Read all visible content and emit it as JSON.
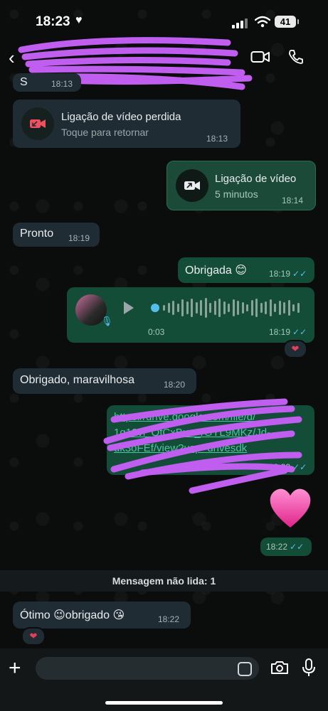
{
  "status_bar": {
    "time": "18:23",
    "heart": "♥",
    "battery": "41"
  },
  "header": {
    "back": "‹",
    "contact_name": ""
  },
  "messages": {
    "partial_top": {
      "text": "S",
      "time": "18:13"
    },
    "missed_call": {
      "title": "Ligação de vídeo perdida",
      "subtitle": "Toque para retornar",
      "time": "18:13"
    },
    "video_call": {
      "title": "Ligação de vídeo",
      "subtitle": "5 minutos",
      "time": "18:14"
    },
    "pronto": {
      "text": "Pronto",
      "time": "18:19"
    },
    "obrigada": {
      "text": "Obrigada 😊",
      "time": "18:19",
      "ticks": "✓✓"
    },
    "voice": {
      "duration": "0:03",
      "time": "18:19",
      "ticks": "✓✓",
      "reaction": "❤"
    },
    "obrigado": {
      "text": "Obrigado,  maravilhosa",
      "time": "18:20"
    },
    "link": {
      "line1": "https://drive.google.com/file/d/",
      "line2": "1g12vl_QfCxBuu_rGYL9MKz/Jd-",
      "line3": "uk3oFEf/view?usp=drivesdk",
      "time": "18:22",
      "ticks": "✓✓"
    },
    "heart": {
      "emoji": "💗",
      "time": "18:22",
      "ticks": "✓✓"
    },
    "otimo": {
      "text": "Ótimo 😉obrigado 😘",
      "time": "18:22",
      "reaction": "❤"
    }
  },
  "unread_label": "Mensagem não lida: 1",
  "colors": {
    "incoming": "#202c33",
    "outgoing": "#144d37",
    "tick": "#53bdeb",
    "scribble": "#c05ef0"
  }
}
